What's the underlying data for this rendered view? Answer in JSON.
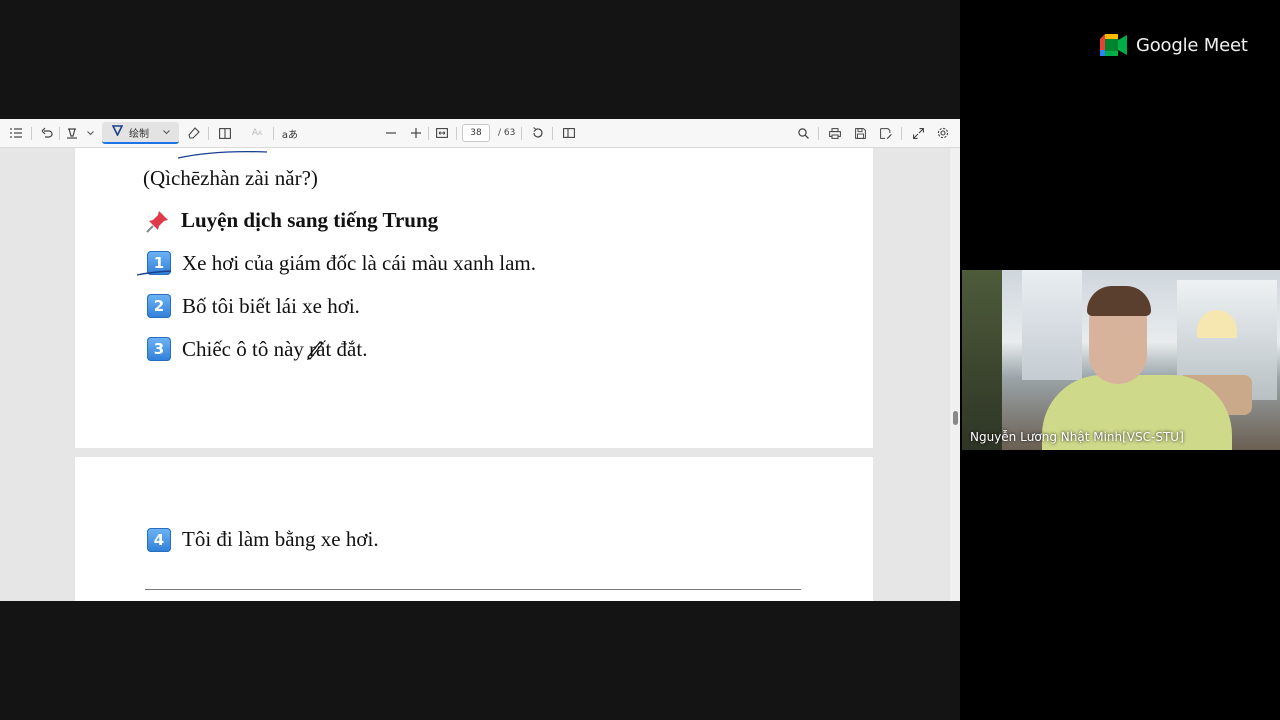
{
  "brand": {
    "name": "Google Meet",
    "icon": "google-meet-camera-icon",
    "colors": [
      "#00832d",
      "#0066da",
      "#e94235",
      "#2684fc",
      "#00ac47",
      "#ffba00"
    ]
  },
  "pdf_viewer": {
    "toolbar": {
      "draw_label": "绘制",
      "read_aloud_label": "aあ",
      "page_number": "38",
      "page_total": "/ 63",
      "icons": [
        "contents-icon",
        "undo-icon",
        "highlight-icon",
        "draw-icon",
        "eraser-icon",
        "page-view-icon",
        "text-size-icon",
        "read-aloud-icon",
        "zoom-out-icon",
        "zoom-in-icon",
        "fit-width-icon",
        "rotate-icon",
        "two-page-icon",
        "search-icon",
        "print-icon",
        "save-icon",
        "save-as-icon",
        "fullscreen-icon",
        "settings-icon"
      ]
    },
    "page1": {
      "pinyin_line": "(Qìchēzhàn zài nǎr?)",
      "heading_icon": "pushpin-icon",
      "heading": "Luyện dịch sang tiếng Trung",
      "items": [
        {
          "badge": "1",
          "text": "Xe hơi của giám đốc là cái màu xanh lam."
        },
        {
          "badge": "2",
          "text": "Bố tôi biết lái xe hơi."
        },
        {
          "badge": "3",
          "text": "Chiếc ô tô này rất đắt."
        }
      ]
    },
    "page2": {
      "items": [
        {
          "badge": "4",
          "text": "Tôi đi làm bằng xe hơi."
        }
      ]
    },
    "annotation_color": "#1a3f8f"
  },
  "participant": {
    "name": "Nguyễn Lương Nhật Minh[VSC-STU]"
  }
}
